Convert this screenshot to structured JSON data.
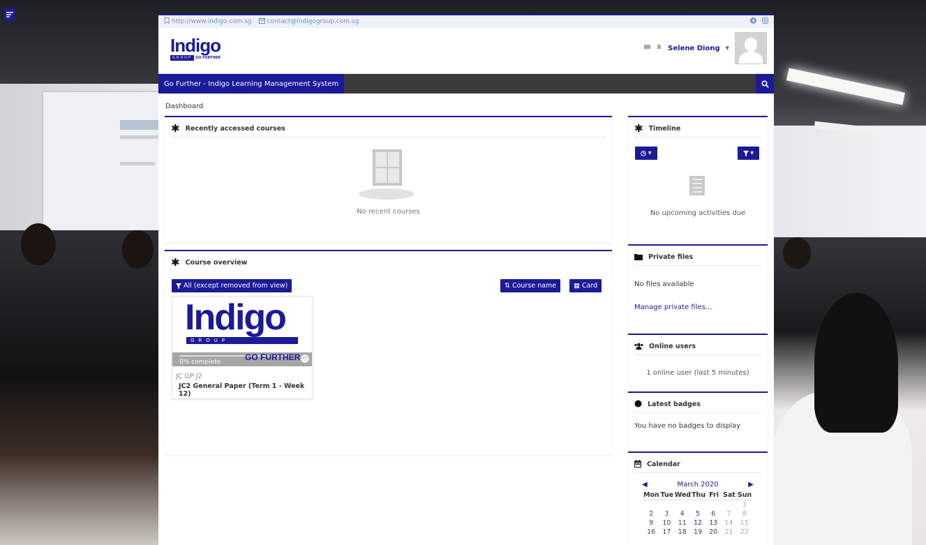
{
  "topbar": {
    "website": "http://www.indigo.com.sg",
    "email": "contact@indigogroup.com.sg"
  },
  "header": {
    "logo_word": "Indigo",
    "logo_group": "GROUP",
    "logo_tagline": "GO FURTHER",
    "user_name": "Selene Diong"
  },
  "navbar": {
    "site_name": "Go Further - Indigo Learning Management System"
  },
  "breadcrumb": "Dashboard",
  "recent": {
    "title": "Recently accessed courses",
    "empty": "No recent courses"
  },
  "overview": {
    "title": "Course overview",
    "filter_label": "All (except removed from view)",
    "sort_label": "Course name",
    "view_label": "Card",
    "course": {
      "image_word": "Indigo",
      "image_group": "GROUP",
      "image_tagline": "GO FURTHER",
      "progress_text": "0% complete",
      "progress": 0,
      "category": "JC GP J2",
      "name": "JC2 General Paper (Term 1 - Week 12)"
    }
  },
  "timeline": {
    "title": "Timeline",
    "empty": "No upcoming activities due"
  },
  "private_files": {
    "title": "Private files",
    "empty": "No files available",
    "manage_link": "Manage private files..."
  },
  "online_users": {
    "title": "Online users",
    "text": "1 online user (last 5 minutes)"
  },
  "badges": {
    "title": "Latest badges",
    "text": "You have no badges to display"
  },
  "calendar": {
    "title": "Calendar",
    "month": "March 2020",
    "days": [
      "Mon",
      "Tue",
      "Wed",
      "Thu",
      "Fri",
      "Sat",
      "Sun"
    ],
    "weeks": [
      [
        "",
        "",
        "",
        "",
        "",
        "",
        "1"
      ],
      [
        "2",
        "3",
        "4",
        "5",
        "6",
        "7",
        "8"
      ],
      [
        "9",
        "10",
        "11",
        "12",
        "13",
        "14",
        "15"
      ],
      [
        "16",
        "17",
        "18",
        "19",
        "20",
        "21",
        "22"
      ]
    ],
    "today": "12"
  },
  "colors": {
    "brand": "#1b1a97",
    "nav_dark": "#3a3a3a"
  }
}
